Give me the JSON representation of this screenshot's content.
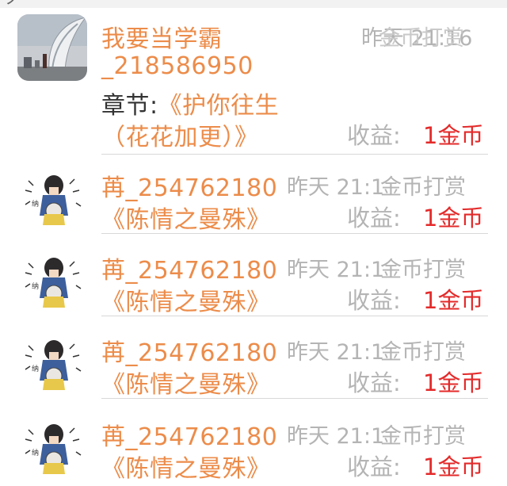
{
  "top_bar": {
    "left_glyph": "ノ",
    "mid_glyph": "一"
  },
  "earn_label": "收益:",
  "items": [
    {
      "user": "我要当学霸",
      "user_id": "_218586950",
      "time": "昨天 21:16",
      "action": "金币打赏",
      "chapter_label": "章节:",
      "book_line1": "《护你往生",
      "book_line2": "（花花加更）》",
      "earn_value": "1金币",
      "avatar": "ship-photo"
    },
    {
      "user": "苒_254762180",
      "time": "昨天 21:1",
      "action": "金币打赏",
      "book": "《陈情之曼殊》",
      "earn_value": "1金币",
      "avatar": "cartoon-drawing"
    },
    {
      "user": "苒_254762180",
      "time": "昨天 21:1",
      "action": "金币打赏",
      "book": "《陈情之曼殊》",
      "earn_value": "1金币",
      "avatar": "cartoon-drawing"
    },
    {
      "user": "苒_254762180",
      "time": "昨天 21:1",
      "action": "金币打赏",
      "book": "《陈情之曼殊》",
      "earn_value": "1金币",
      "avatar": "cartoon-drawing"
    },
    {
      "user": "苒_254762180",
      "time": "昨天 21:1",
      "action": "金币打赏",
      "book": "《陈情之曼殊》",
      "earn_value": "1金币",
      "avatar": "cartoon-drawing"
    }
  ],
  "colors": {
    "orange": "#ec8c4a",
    "gray": "#b4b4b4",
    "red": "#e42a2a",
    "divider": "#d8d8d8"
  }
}
